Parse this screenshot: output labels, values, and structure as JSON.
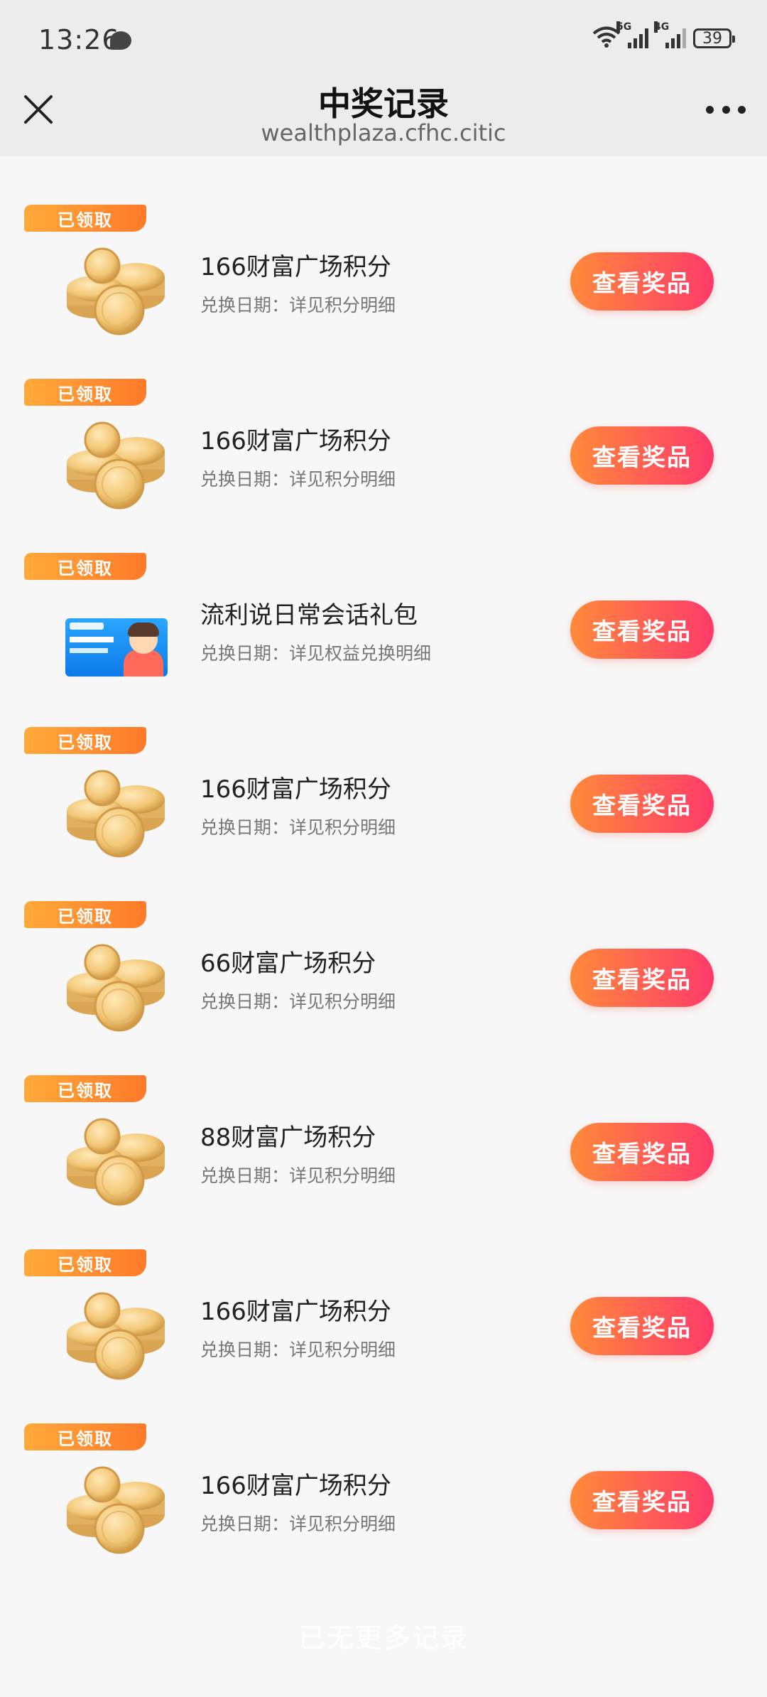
{
  "status_bar": {
    "time": "13:26",
    "signal_1_label": "5G",
    "signal_2_label": "4G",
    "battery": "39"
  },
  "header": {
    "title": "中奖记录",
    "url": "wealthplaza.cfhc.citic"
  },
  "records": [
    {
      "badge": "已领取",
      "title": "166财富广场积分",
      "date_text": "兑换日期：详见积分明细",
      "button": "查看奖品",
      "icon": "coins-icon"
    },
    {
      "badge": "已领取",
      "title": "166财富广场积分",
      "date_text": "兑换日期：详见积分明细",
      "button": "查看奖品",
      "icon": "coins-icon"
    },
    {
      "badge": "已领取",
      "title": "流利说日常会话礼包",
      "date_text": "兑换日期：详见权益兑换明细",
      "button": "查看奖品",
      "icon": "voucher-icon"
    },
    {
      "badge": "已领取",
      "title": "166财富广场积分",
      "date_text": "兑换日期：详见积分明细",
      "button": "查看奖品",
      "icon": "coins-icon"
    },
    {
      "badge": "已领取",
      "title": "66财富广场积分",
      "date_text": "兑换日期：详见积分明细",
      "button": "查看奖品",
      "icon": "coins-icon"
    },
    {
      "badge": "已领取",
      "title": "88财富广场积分",
      "date_text": "兑换日期：详见积分明细",
      "button": "查看奖品",
      "icon": "coins-icon"
    },
    {
      "badge": "已领取",
      "title": "166财富广场积分",
      "date_text": "兑换日期：详见积分明细",
      "button": "查看奖品",
      "icon": "coins-icon"
    },
    {
      "badge": "已领取",
      "title": "166财富广场积分",
      "date_text": "兑换日期：详见积分明细",
      "button": "查看奖品",
      "icon": "coins-icon"
    }
  ],
  "footer": {
    "text": "已无更多记录"
  },
  "colors": {
    "badge": "#ff8f33",
    "button_start": "#ff8a3a",
    "button_end": "#ff3a6a",
    "background": "#f7f7f7"
  }
}
